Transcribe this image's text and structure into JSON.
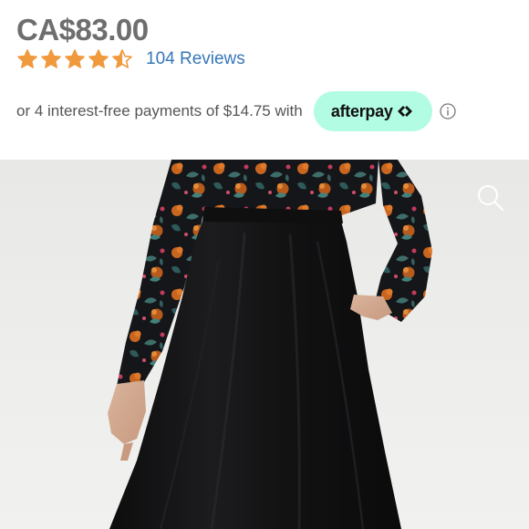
{
  "product": {
    "price": "CA$83.00",
    "rating": 4.5,
    "rating_max": 5,
    "reviews_label": "104 Reviews"
  },
  "payments": {
    "text": "or 4 interest-free payments of $14.75 with",
    "provider_label": "afterpay"
  },
  "icons": {
    "star": "star-icon",
    "afterpay_logo": "afterpay-arrows-icon",
    "info": "info-icon",
    "zoom": "zoom-icon"
  },
  "colors": {
    "price": "#6e6e6e",
    "star": "#f0993d",
    "link": "#3677b8",
    "afterpay_bg": "#b2fce4"
  }
}
